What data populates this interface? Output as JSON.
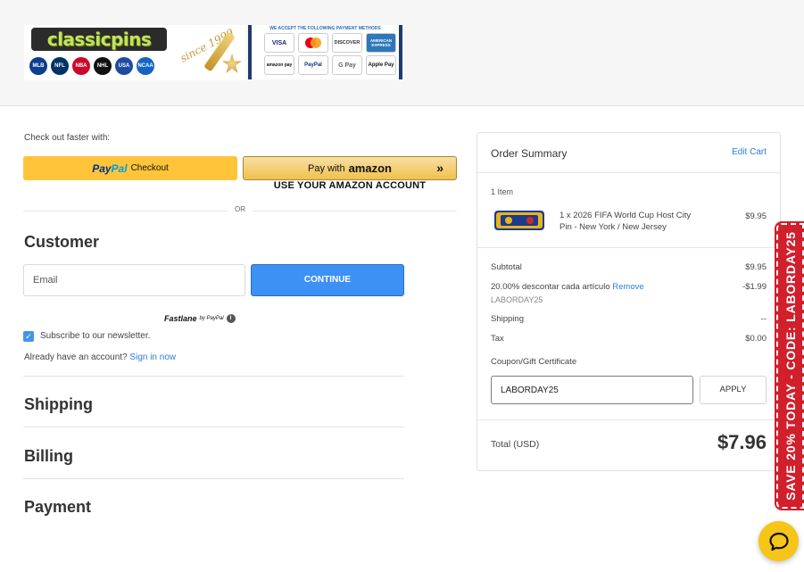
{
  "header": {
    "logo_text": "classicpins",
    "since_text": "since 1999",
    "league_logos": [
      "MLB",
      "NFL",
      "NBA",
      "NHL",
      "USA",
      "NCAA"
    ],
    "payment_heading": "WE ACCEPT THE FOLLOWING PAYMENT METHODS",
    "payment_methods": [
      "VISA",
      "mastercard",
      "DISCOVER",
      "AMERICAN EXPRESS",
      "amazon pay",
      "PayPal",
      "G Pay",
      "Apple Pay"
    ]
  },
  "checkout": {
    "faster_label": "Check out faster with:",
    "paypal_label": "PayPal",
    "paypal_checkout": "Checkout",
    "amazon_prefix": "Pay with",
    "amazon_word": "amazon",
    "amazon_sub": "USE YOUR AMAZON ACCOUNT",
    "or_text": "OR"
  },
  "customer": {
    "title": "Customer",
    "email_placeholder": "Email",
    "continue_label": "CONTINUE",
    "fastlane_label": "Fastlane",
    "fastlane_by": "by PayPal",
    "newsletter_label": "Subscribe to our newsletter.",
    "newsletter_checked": true,
    "already_text": "Already have an account?",
    "sign_in_label": "Sign in now"
  },
  "sections": {
    "shipping": "Shipping",
    "billing": "Billing",
    "payment": "Payment"
  },
  "summary": {
    "title": "Order Summary",
    "edit_cart": "Edit Cart",
    "item_count": "1 Item",
    "item_name": "1 x 2026 FIFA World Cup Host City Pin - New York / New Jersey",
    "item_price": "$9.95",
    "subtotal_label": "Subtotal",
    "subtotal_value": "$9.95",
    "discount_label": "20.00% descontar cada artículo",
    "discount_remove": "Remove",
    "discount_code": "LABORDAY25",
    "discount_value": "-$1.99",
    "shipping_label": "Shipping",
    "shipping_value": "--",
    "tax_label": "Tax",
    "tax_value": "$0.00",
    "coupon_label": "Coupon/Gift Certificate",
    "coupon_value": "LABORDAY25",
    "apply_label": "APPLY",
    "total_label": "Total (USD)",
    "total_value": "$7.96"
  },
  "promo": {
    "text": "SAVE 20% TODAY - CODE: LABORDAY25",
    "color": "#d11f2c"
  },
  "chat": {
    "icon": "chat-bubble-icon",
    "color": "#f5c518"
  }
}
